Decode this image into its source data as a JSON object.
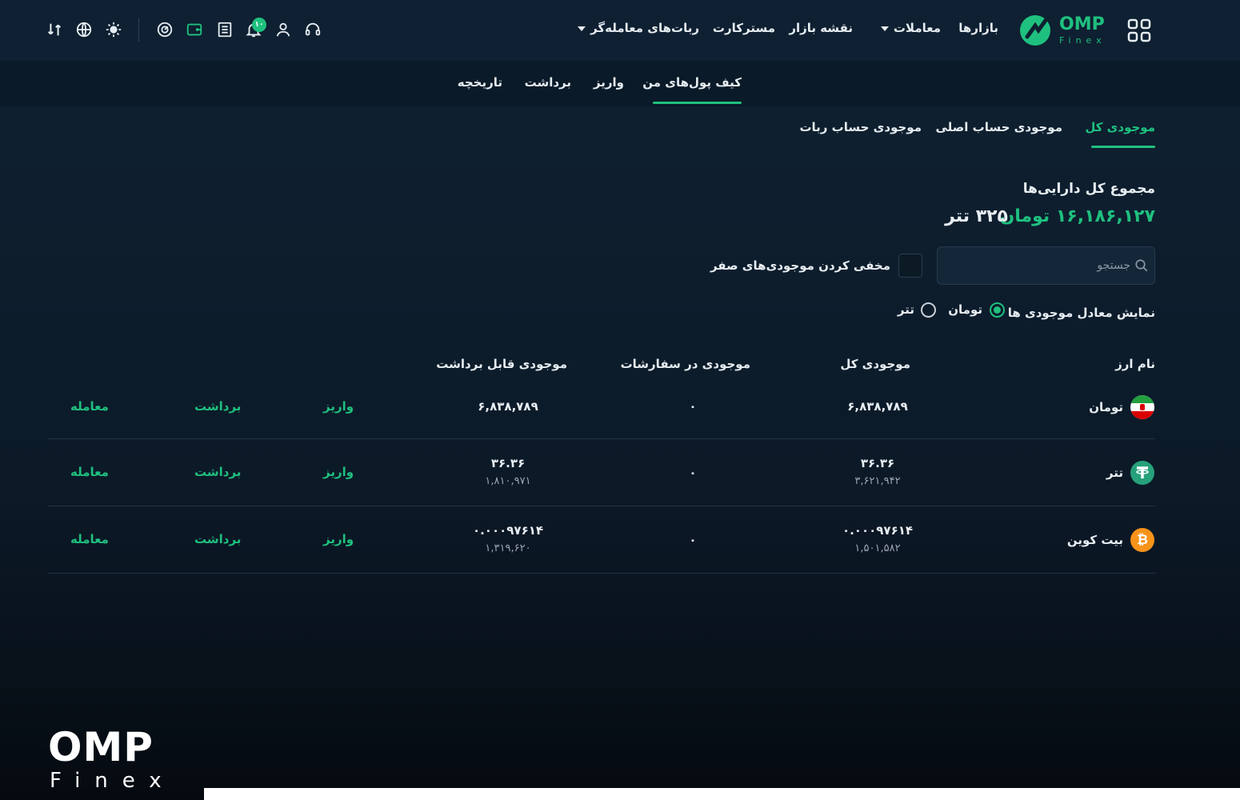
{
  "brand": {
    "name": "OMP",
    "sub": "Finex"
  },
  "nav": {
    "markets": "بازارها",
    "trades": "معاملات",
    "market_map": "نقشه بازار",
    "mastercard": "مسترکارت",
    "bots": "ربات‌های معامله‌گر",
    "notification_count": "۱۰"
  },
  "subnav": {
    "my_wallets": "کیف پول‌های من",
    "deposit": "واریز",
    "withdraw": "برداشت",
    "history": "تاریخچه"
  },
  "tabs": {
    "total": "موجودی کل",
    "main": "موجودی حساب اصلی",
    "bot": "موجودی حساب ربات"
  },
  "summary": {
    "title": "مجموع کل دارایی‌ها",
    "toman": "۱۶,۱۸۶,۱۲۷ تومان",
    "tether": "۳۲۵ تتر"
  },
  "search": {
    "placeholder": "جستجو"
  },
  "hide_zero": "مخفی کردن موجودی‌های صفر",
  "equivalent": {
    "label": "نمایش معادل موجودی ها",
    "toman": "تومان",
    "tether": "تتر",
    "selected": "toman"
  },
  "table": {
    "headers": {
      "currency": "نام ارز",
      "total": "موجودی کل",
      "in_orders": "موجودی در سفارشات",
      "withdrawable": "موجودی قابل برداشت"
    },
    "actions": {
      "deposit": "واریز",
      "withdraw": "برداشت",
      "trade": "معامله"
    },
    "rows": [
      {
        "name": "تومان",
        "icon": "iran-flag-icon",
        "total": "۶,۸۳۸,۷۸۹",
        "total_sub": "",
        "orders": "۰",
        "withdrawable": "۶,۸۳۸,۷۸۹",
        "withdrawable_sub": ""
      },
      {
        "name": "تتر",
        "icon": "tether-icon",
        "total": "۳۶.۳۶",
        "total_sub": "۳,۶۲۱,۹۴۲",
        "orders": "۰",
        "withdrawable": "۳۶.۳۶",
        "withdrawable_sub": "۱,۸۱۰,۹۷۱"
      },
      {
        "name": "بیت کوین",
        "icon": "bitcoin-icon",
        "total": "۰.۰۰۰۹۷۶۱۴",
        "total_sub": "۱,۵۰۱,۵۸۲",
        "orders": "۰",
        "withdrawable": "۰.۰۰۰۹۷۶۱۴",
        "withdrawable_sub": "۱,۳۱۹,۶۲۰"
      }
    ]
  },
  "colors": {
    "accent": "#1fc07f",
    "background": "#0f2132"
  }
}
